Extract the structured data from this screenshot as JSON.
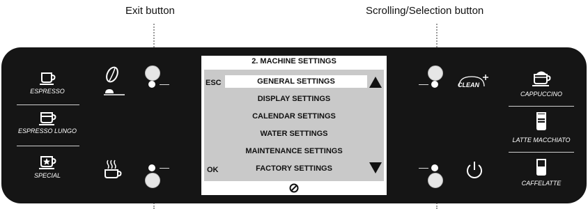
{
  "callouts": {
    "exit": "Exit button",
    "scroll": "Scrolling/Selection button"
  },
  "left_buttons": [
    {
      "label": "ESPRESSO",
      "icon": "espresso-cup-icon"
    },
    {
      "label": "ESPRESSO LUNGO",
      "icon": "lungo-cup-icon"
    },
    {
      "label": "SPECIAL",
      "icon": "special-star-cup-icon"
    }
  ],
  "right_buttons": [
    {
      "label": "CAPPUCCINO",
      "icon": "cappuccino-cup-icon"
    },
    {
      "label": "LATTE MACCHIATO",
      "icon": "latte-glass-icon"
    },
    {
      "label": "CAFFELATTE",
      "icon": "caffelatte-glass-icon"
    }
  ],
  "aux_icons": {
    "pre_ground": "ground-coffee-icon",
    "hot_water": "hot-water-icon",
    "clean": "CLEAN",
    "power": "power-icon"
  },
  "display": {
    "title": "2. MACHINE SETTINGS",
    "esc_label": "ESC",
    "ok_label": "OK",
    "items": [
      "GENERAL SETTINGS",
      "DISPLAY SETTINGS",
      "CALENDAR SETTINGS",
      "WATER SETTINGS",
      "MAINTENANCE SETTINGS",
      "FACTORY SETTINGS"
    ],
    "selected_index": 0,
    "footer_icon": "bean-symbol-icon"
  },
  "colors": {
    "panel": "#151515",
    "screen_bg": "#c9c9c9",
    "text_light": "#ffffff"
  }
}
